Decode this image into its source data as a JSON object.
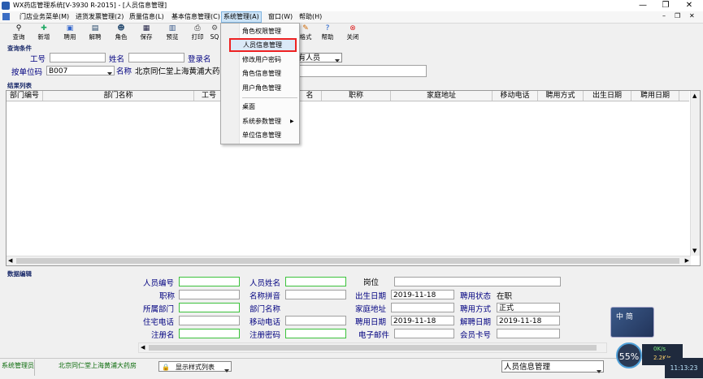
{
  "window": {
    "title": "WX药店管理系统[V-3930 R-2015] - [人员信息管理]"
  },
  "menubar": {
    "items": [
      "门店业务菜单(M)",
      "进货发票管理(2)",
      "质量信息(L)",
      "基本信息管理(C)",
      "系统管理(A)",
      "窗口(W)",
      "帮助(H)"
    ]
  },
  "toolbar": {
    "buttons": [
      {
        "label": "查询",
        "icon": "binoculars-icon"
      },
      {
        "label": "新增",
        "icon": "new-icon"
      },
      {
        "label": "聘用",
        "icon": "hire-icon"
      },
      {
        "label": "解聘",
        "icon": "dismiss-icon"
      },
      {
        "label": "角色",
        "icon": "role-icon"
      },
      {
        "label": "保存",
        "icon": "save-icon"
      },
      {
        "label": "预览",
        "icon": "preview-icon"
      },
      {
        "label": "打印",
        "icon": "print-icon"
      },
      {
        "label": "SQ",
        "icon": "sql-icon"
      },
      {
        "label": "格式",
        "icon": "format-icon"
      },
      {
        "label": "帮助",
        "icon": "help-icon"
      },
      {
        "label": "关闭",
        "icon": "close-icon"
      }
    ]
  },
  "dropdown": {
    "items": [
      "角色权限管理",
      "人员信息管理",
      "修改用户密码",
      "角色信息管理",
      "用户角色管理",
      "桌面",
      "系统参数管理",
      "单位信息管理"
    ],
    "selected": "人员信息管理"
  },
  "query": {
    "section_title": "查询条件",
    "gonghao_label": "工号",
    "xingming_label": "姓名",
    "denglu_label": "登录名",
    "status_value": "有人员",
    "unit_label": "按单位码",
    "unit_value": "B007",
    "name_label": "名称",
    "name_value": "北京同仁堂上海黄浦大药"
  },
  "results": {
    "section_title": "结果列表",
    "columns": [
      "部门编号",
      "部门名称",
      "工号",
      "名",
      "职称",
      "家庭地址",
      "移动电话",
      "聘用方式",
      "出生日期",
      "聘用日期"
    ]
  },
  "edit": {
    "section_title": "数据编辑",
    "fields": {
      "renyuan_bianhao": "人员编号",
      "renyuan_xingming": "人员姓名",
      "gangwei": "岗位",
      "zhicheng": "职称",
      "mingcheng_pinyin": "名称拼音",
      "chusheng_riqi": "出生日期",
      "chusheng_riqi_value": "2019-11-18",
      "pinyong_zhuangtai": "聘用状态",
      "pinyong_zhuangtai_value": "在职",
      "suoshu_bumen": "所属部门",
      "bumen_mingcheng": "部门名称",
      "jiating_dizhi": "家庭地址",
      "pinyong_fangshi": "聘用方式",
      "pinyong_fangshi_value": "正式",
      "zhuzhai_dianhua": "住宅电话",
      "yidong_dianhua": "移动电话",
      "pinyong_riqi": "聘用日期",
      "pinyong_riqi_value": "2019-11-18",
      "jiepin_riqi": "解聘日期",
      "jiepin_riqi_value": "2019-11-18",
      "zhuce_ming": "注册名",
      "zhuce_mima": "注册密码",
      "dianzi_youjian": "电子邮件",
      "huiyuan_kahao": "会员卡号"
    }
  },
  "statusbar": {
    "user": "系统管理员",
    "store": "北京同仁堂上海黄浦大药房",
    "style_list": "显示样式列表",
    "module": "人员信息管理"
  },
  "tray": {
    "gauge_percent": "55%",
    "up_speed": "0K/s",
    "down_speed": "2.2K/s",
    "time": "11:13:23",
    "badge_text": "中 简"
  }
}
